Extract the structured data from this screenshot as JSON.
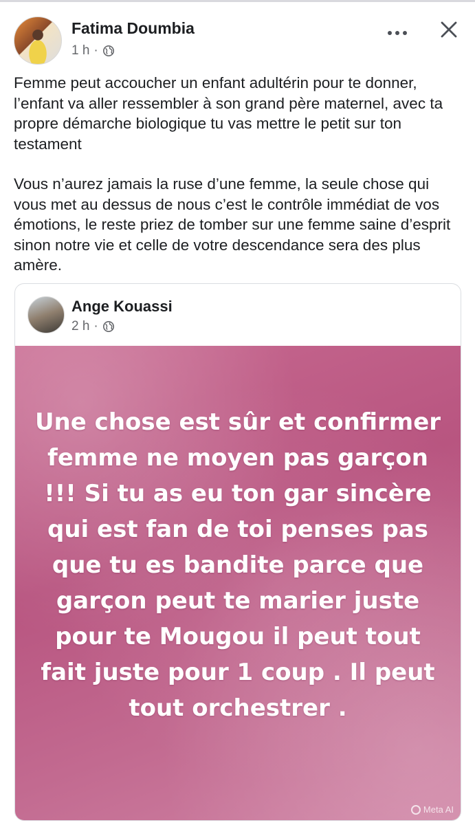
{
  "post": {
    "author": "Fatima Doumbia",
    "time": "1 h",
    "separator": "·",
    "text_paragraphs": [
      "Femme peut accoucher un enfant adultérin pour te donner, l’enfant va aller ressembler à son grand père maternel, avec ta propre démarche biologique tu vas mettre le petit sur ton testament",
      "Vous n’aurez jamais la ruse d’une femme, la seule chose qui vous met au dessus de nous c’est le contrôle immédiat de vos émotions, le reste priez de tomber sur une femme saine d’esprit sinon notre vie et celle de votre descendance sera des plus amère."
    ]
  },
  "shared": {
    "author": "Ange Kouassi",
    "time": "2 h",
    "separator": "·",
    "image_text": "Une chose est sûr et confirmer femme ne moyen pas garçon !!! Si tu as eu ton gar sincère qui est fan de toi penses pas que tu es bandite parce que garçon peut te marier juste pour te Mougou il peut tout fait juste pour 1 coup . Il peut tout orchestrer .",
    "watermark": "Meta AI"
  },
  "icons": {
    "privacy": "globe-icon",
    "more": "more-options-icon",
    "close": "close-icon"
  },
  "colors": {
    "text": "#1c1e21",
    "meta": "#65676b",
    "image_background": "#c0628a"
  }
}
